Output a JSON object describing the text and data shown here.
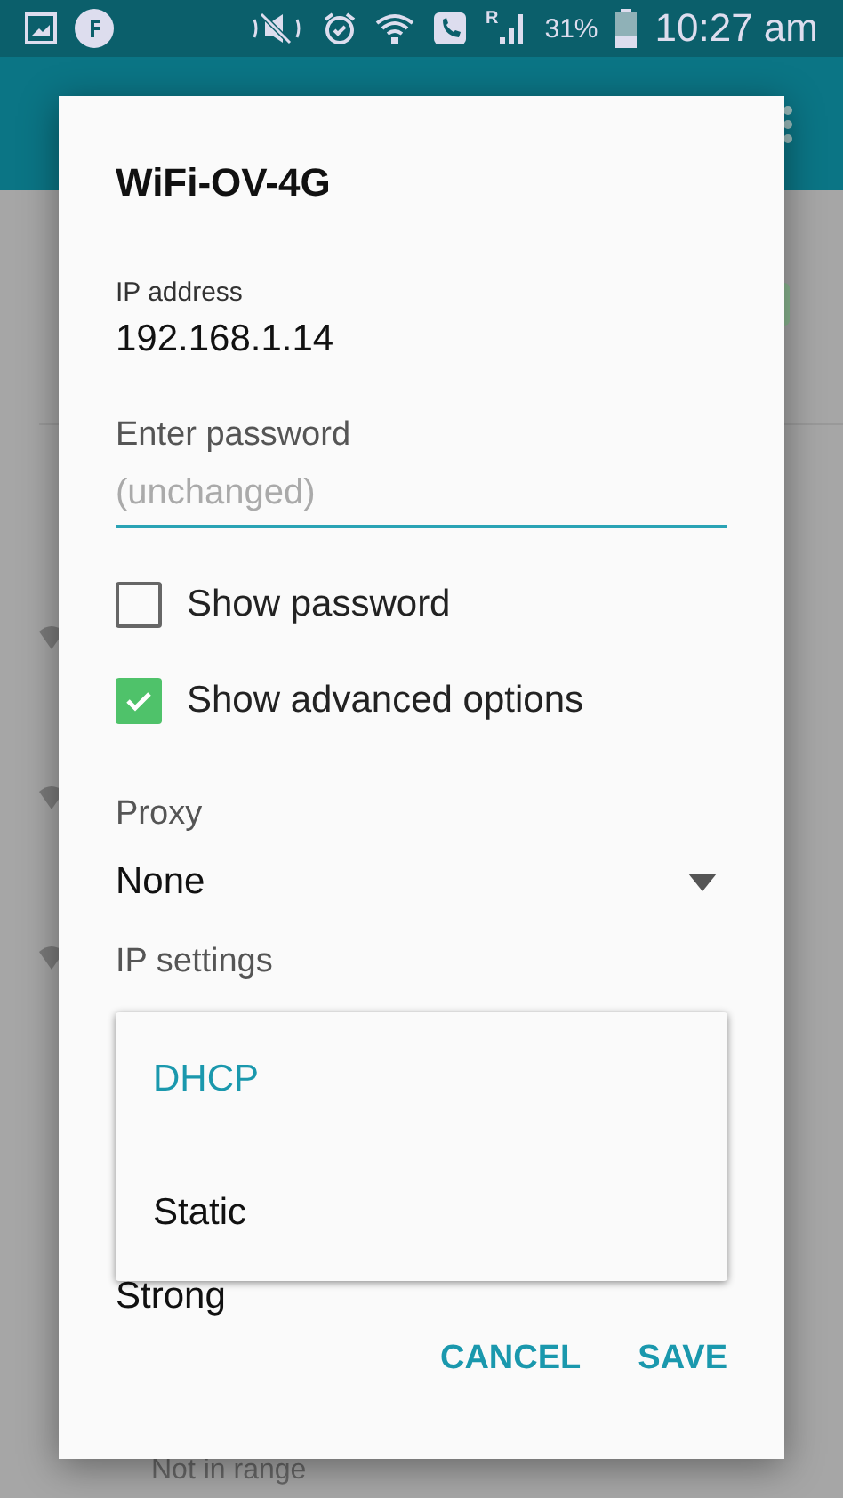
{
  "status_bar": {
    "battery": "31%",
    "time": "10:27 am",
    "roaming": "R"
  },
  "background": {
    "toggle_on": true,
    "footer": "Not in range"
  },
  "dialog": {
    "title": "WiFi-OV-4G",
    "fields": [
      {
        "label": "IP address",
        "value": "192.168.1.14"
      }
    ],
    "password": {
      "label": "Enter password",
      "placeholder": "(unchanged)"
    },
    "checkboxes": [
      {
        "label": "Show password",
        "checked": false
      },
      {
        "label": "Show advanced options",
        "checked": true
      }
    ],
    "proxy": {
      "label": "Proxy",
      "value": "None"
    },
    "ip_settings": {
      "label": "IP settings"
    },
    "strength": "Strong",
    "buttons": [
      "CANCEL",
      "SAVE"
    ]
  },
  "dropdown": {
    "options": [
      {
        "label": "DHCP",
        "selected": true
      },
      {
        "label": "Static",
        "selected": false
      }
    ]
  }
}
